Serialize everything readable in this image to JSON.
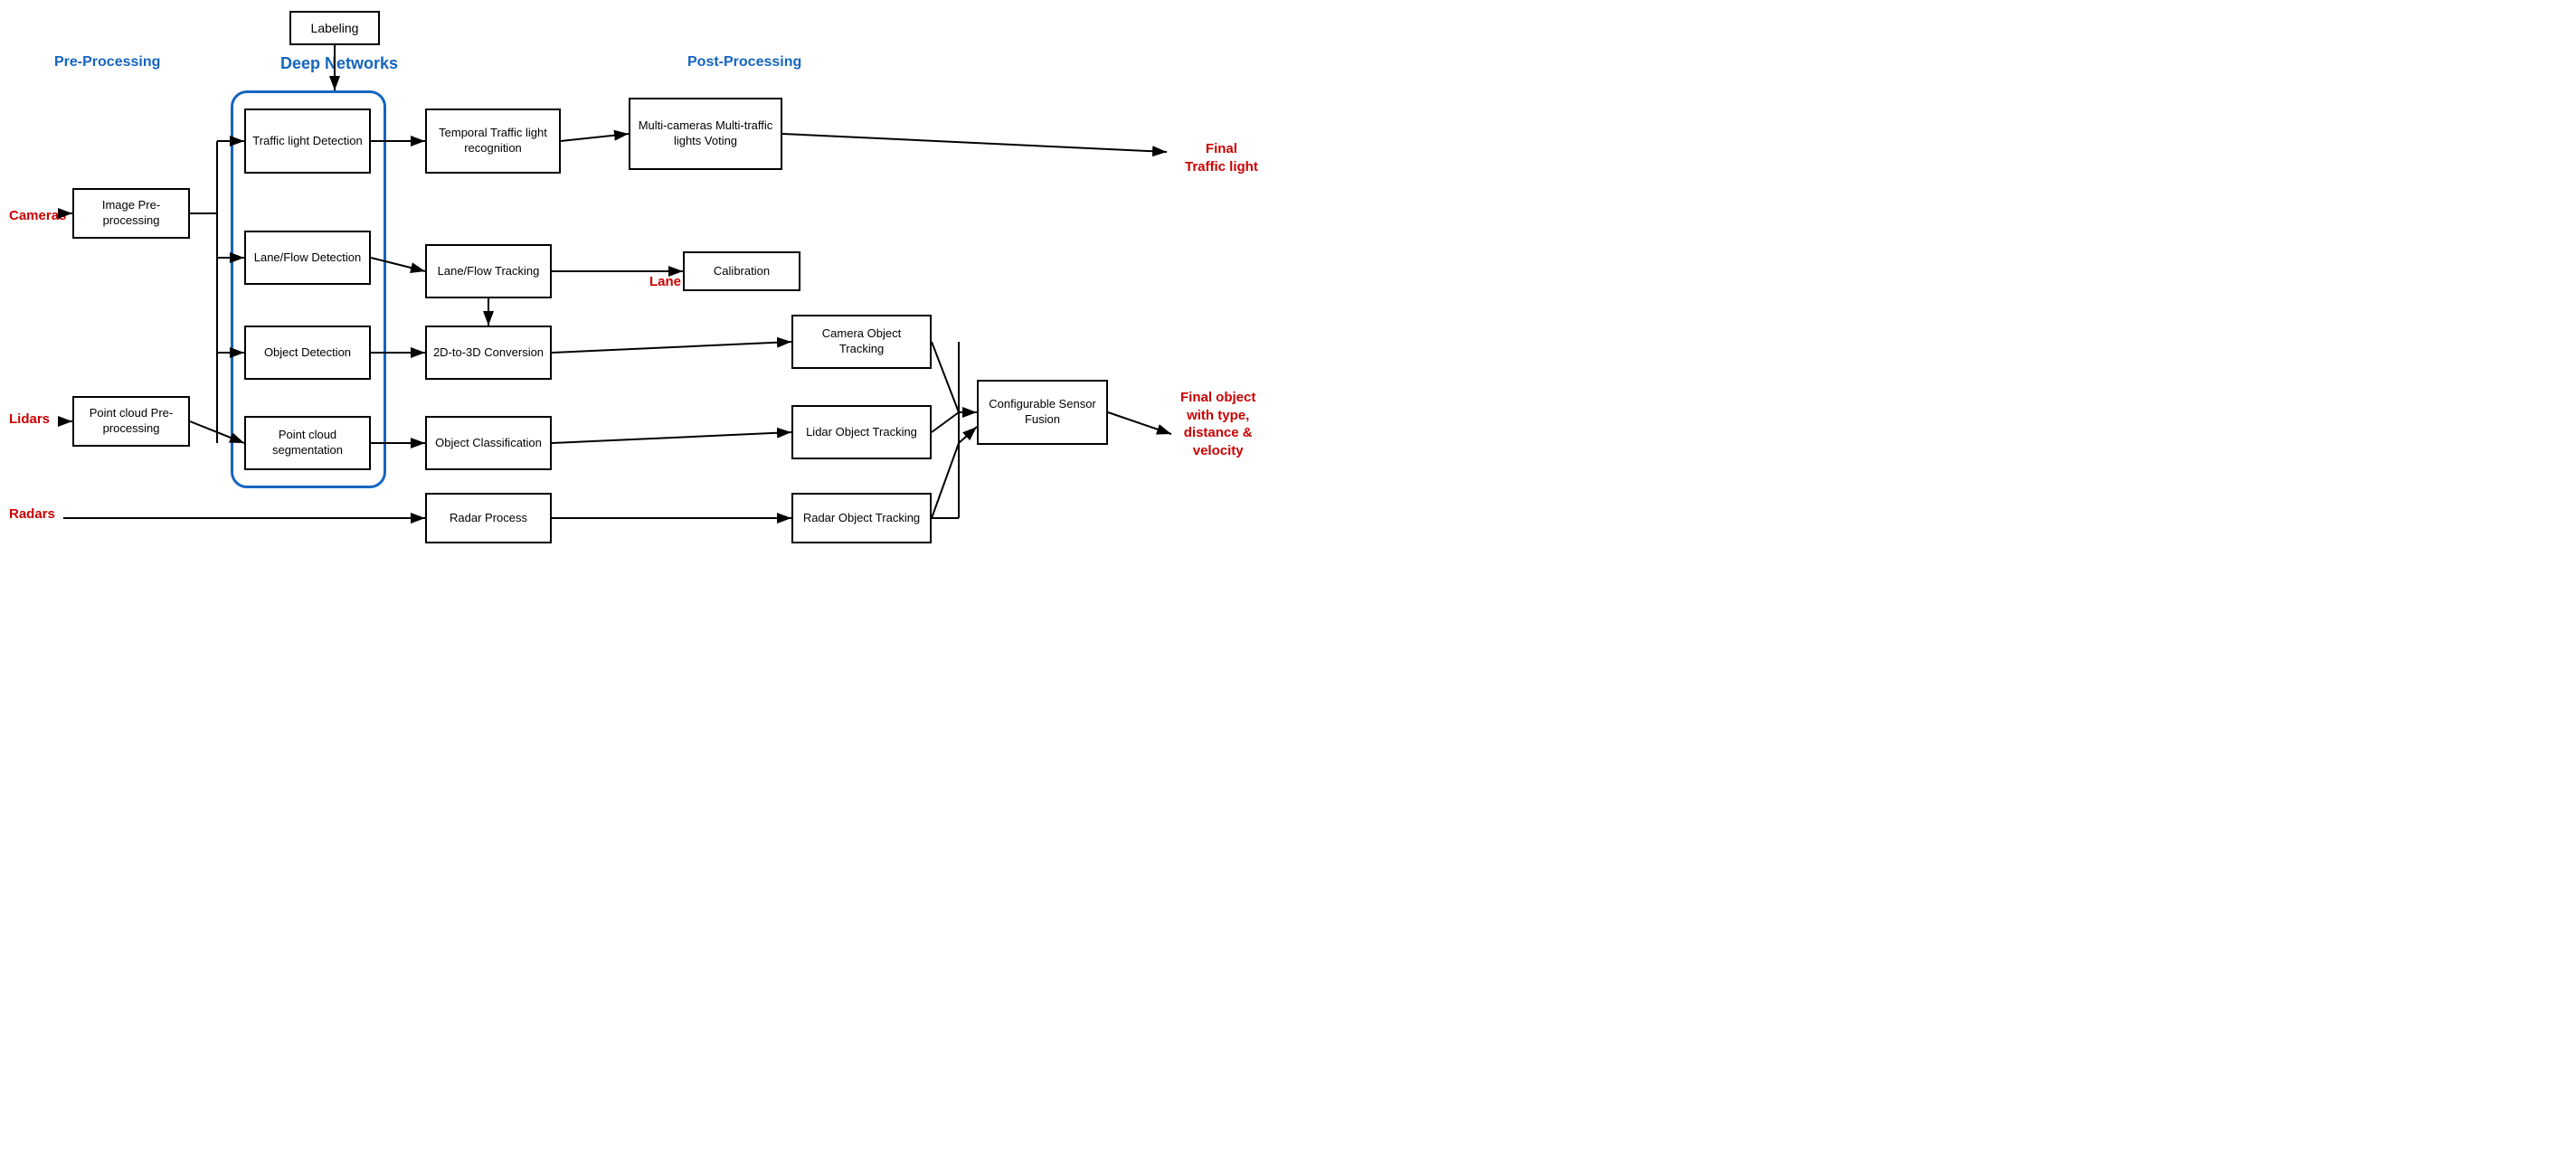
{
  "labels": {
    "pre_processing": "Pre-Processing",
    "deep_networks": "Deep Networks",
    "post_processing": "Post-Processing",
    "cameras": "Cameras",
    "lidars": "Lidars",
    "radars": "Radars",
    "final_traffic_light": "Final\nTraffic light",
    "final_object": "Final object\nwith type,\ndistance &\nvelocity",
    "lane": "Lane"
  },
  "boxes": {
    "labeling": "Labeling",
    "image_preprocessing": "Image\nPre-processing",
    "traffic_light_detection": "Traffic light\nDetection",
    "lane_flow_detection": "Lane/Flow\nDetection",
    "object_detection": "Object\nDetection",
    "point_cloud_preprocessing": "Point cloud\nPre-processing",
    "point_cloud_segmentation": "Point cloud\nsegmentation",
    "temporal_traffic": "Temporal Traffic\nlight recognition",
    "lane_flow_tracking": "Lane/Flow\nTracking",
    "conversion_2d_3d": "2D-to-3D\nConversion",
    "object_classification": "Object\nClassification",
    "radar_process": "Radar\nProcess",
    "multi_cameras": "Multi-cameras\nMulti-traffic lights\nVoting",
    "calibration": "Calibration",
    "camera_object_tracking": "Camera Object\nTracking",
    "lidar_object_tracking": "Lidar Object\nTracking",
    "radar_object_tracking": "Radar Object\nTracking",
    "configurable_sensor_fusion": "Configurable\nSensor Fusion"
  }
}
